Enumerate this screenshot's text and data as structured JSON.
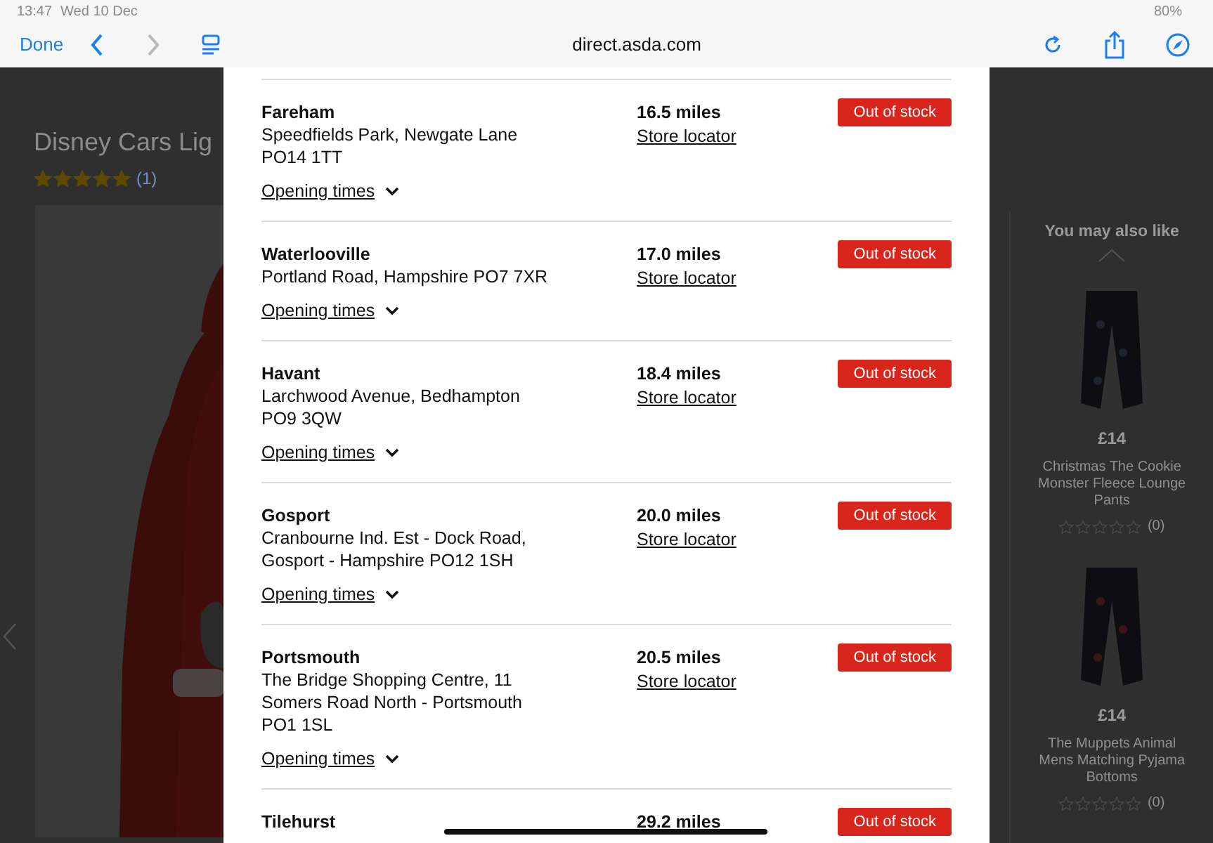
{
  "status_bar": {
    "time": "13:47",
    "date": "Wed 10 Dec",
    "battery": "80%"
  },
  "toolbar": {
    "done": "Done",
    "url": "direct.asda.com"
  },
  "product": {
    "title": "Disney Cars Lig",
    "stars": 5,
    "reviews": "(1)"
  },
  "recommendations": {
    "title": "You may also like",
    "items": [
      {
        "price": "£14",
        "name": "Christmas The Cookie Monster Fleece Lounge Pants",
        "stars": 0,
        "reviews": "(0)"
      },
      {
        "price": "£14",
        "name": "The Muppets Animal Mens Matching Pyjama Bottoms",
        "stars": 0,
        "reviews": "(0)"
      }
    ]
  },
  "stores": [
    {
      "name": "Fareham",
      "address": [
        "Speedfields Park, Newgate Lane",
        "PO14 1TT"
      ],
      "distance": "16.5 miles",
      "link": "Store locator",
      "stock": "Out of stock",
      "opening": "Opening times"
    },
    {
      "name": "Waterlooville",
      "address": [
        "Portland Road, Hampshire PO7 7XR"
      ],
      "distance": "17.0 miles",
      "link": "Store locator",
      "stock": "Out of stock",
      "opening": "Opening times"
    },
    {
      "name": "Havant",
      "address": [
        "Larchwood Avenue, Bedhampton",
        "PO9 3QW"
      ],
      "distance": "18.4 miles",
      "link": "Store locator",
      "stock": "Out of stock",
      "opening": "Opening times"
    },
    {
      "name": "Gosport",
      "address": [
        "Cranbourne Ind. Est - Dock Road,",
        "Gosport - Hampshire PO12 1SH"
      ],
      "distance": "20.0 miles",
      "link": "Store locator",
      "stock": "Out of stock",
      "opening": "Opening times"
    },
    {
      "name": "Portsmouth",
      "address": [
        "The Bridge Shopping Centre, 11",
        "Somers Road North - Portsmouth",
        "PO1 1SL"
      ],
      "distance": "20.5 miles",
      "link": "Store locator",
      "stock": "Out of stock",
      "opening": "Opening times"
    },
    {
      "name": "Tilehurst",
      "distance": "29.2 miles",
      "stock": "Out of stock"
    }
  ]
}
